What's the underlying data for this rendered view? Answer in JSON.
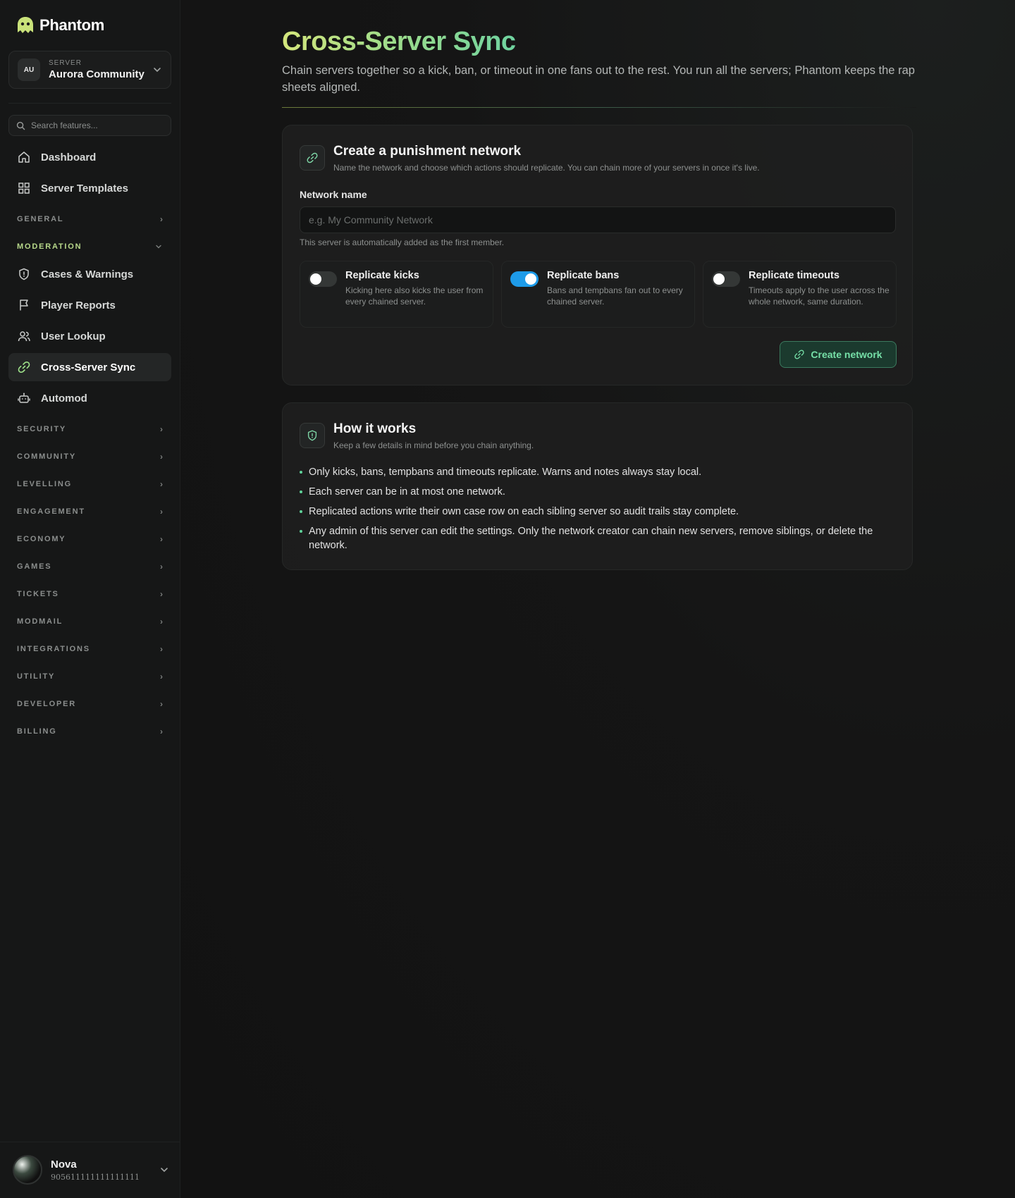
{
  "brand": {
    "name": "Phantom"
  },
  "server": {
    "caption": "SERVER",
    "initials": "AU",
    "name": "Aurora Community"
  },
  "search": {
    "placeholder": "Search features..."
  },
  "nav": {
    "top": [
      {
        "label": "Dashboard",
        "icon": "home-icon"
      },
      {
        "label": "Server Templates",
        "icon": "grid-icon"
      }
    ],
    "general": "GENERAL",
    "moderation": "MODERATION",
    "moderation_items": [
      {
        "label": "Cases & Warnings",
        "icon": "shield-icon"
      },
      {
        "label": "Player Reports",
        "icon": "flag-icon"
      },
      {
        "label": "User Lookup",
        "icon": "users-icon"
      },
      {
        "label": "Cross-Server Sync",
        "icon": "link-icon",
        "active": true
      },
      {
        "label": "Automod",
        "icon": "robot-icon"
      }
    ],
    "sections": [
      "SECURITY",
      "COMMUNITY",
      "LEVELLING",
      "ENGAGEMENT",
      "ECONOMY",
      "GAMES",
      "TICKETS",
      "MODMAIL",
      "INTEGRATIONS",
      "UTILITY",
      "DEVELOPER",
      "BILLING"
    ]
  },
  "user": {
    "name": "Nova",
    "id": "905611111111111111"
  },
  "page": {
    "title": "Cross-Server Sync",
    "subtitle": "Chain servers together so a kick, ban, or timeout in one fans out to the rest. You run all the servers; Phantom keeps the rap sheets aligned."
  },
  "create_card": {
    "title": "Create a punishment network",
    "subtitle": "Name the network and choose which actions should replicate. You can chain more of your servers in once it's live.",
    "field_label": "Network name",
    "field_placeholder": "e.g. My Community Network",
    "field_help": "This server is automatically added as the first member.",
    "options": [
      {
        "title": "Replicate kicks",
        "desc": "Kicking here also kicks the user from every chained server.",
        "enabled": false
      },
      {
        "title": "Replicate bans",
        "desc": "Bans and tempbans fan out to every chained server.",
        "enabled": true
      },
      {
        "title": "Replicate timeouts",
        "desc": "Timeouts apply to the user across the whole network, same duration.",
        "enabled": false
      }
    ],
    "button": "Create network"
  },
  "how_card": {
    "title": "How it works",
    "subtitle": "Keep a few details in mind before you chain anything.",
    "bullets": [
      "Only kicks, bans, tempbans and timeouts replicate. Warns and notes always stay local.",
      "Each server can be in at most one network.",
      "Replicated actions write their own case row on each sibling server so audit trails stay complete.",
      "Any admin of this server can edit the settings. Only the network creator can chain new servers, remove siblings, or delete the network."
    ]
  },
  "colors": {
    "accent_green": "#6fd3a0",
    "title_yellow": "#d4e67c",
    "toggle_on": "#1e9be8",
    "moderation_label": "#b7d88a"
  }
}
